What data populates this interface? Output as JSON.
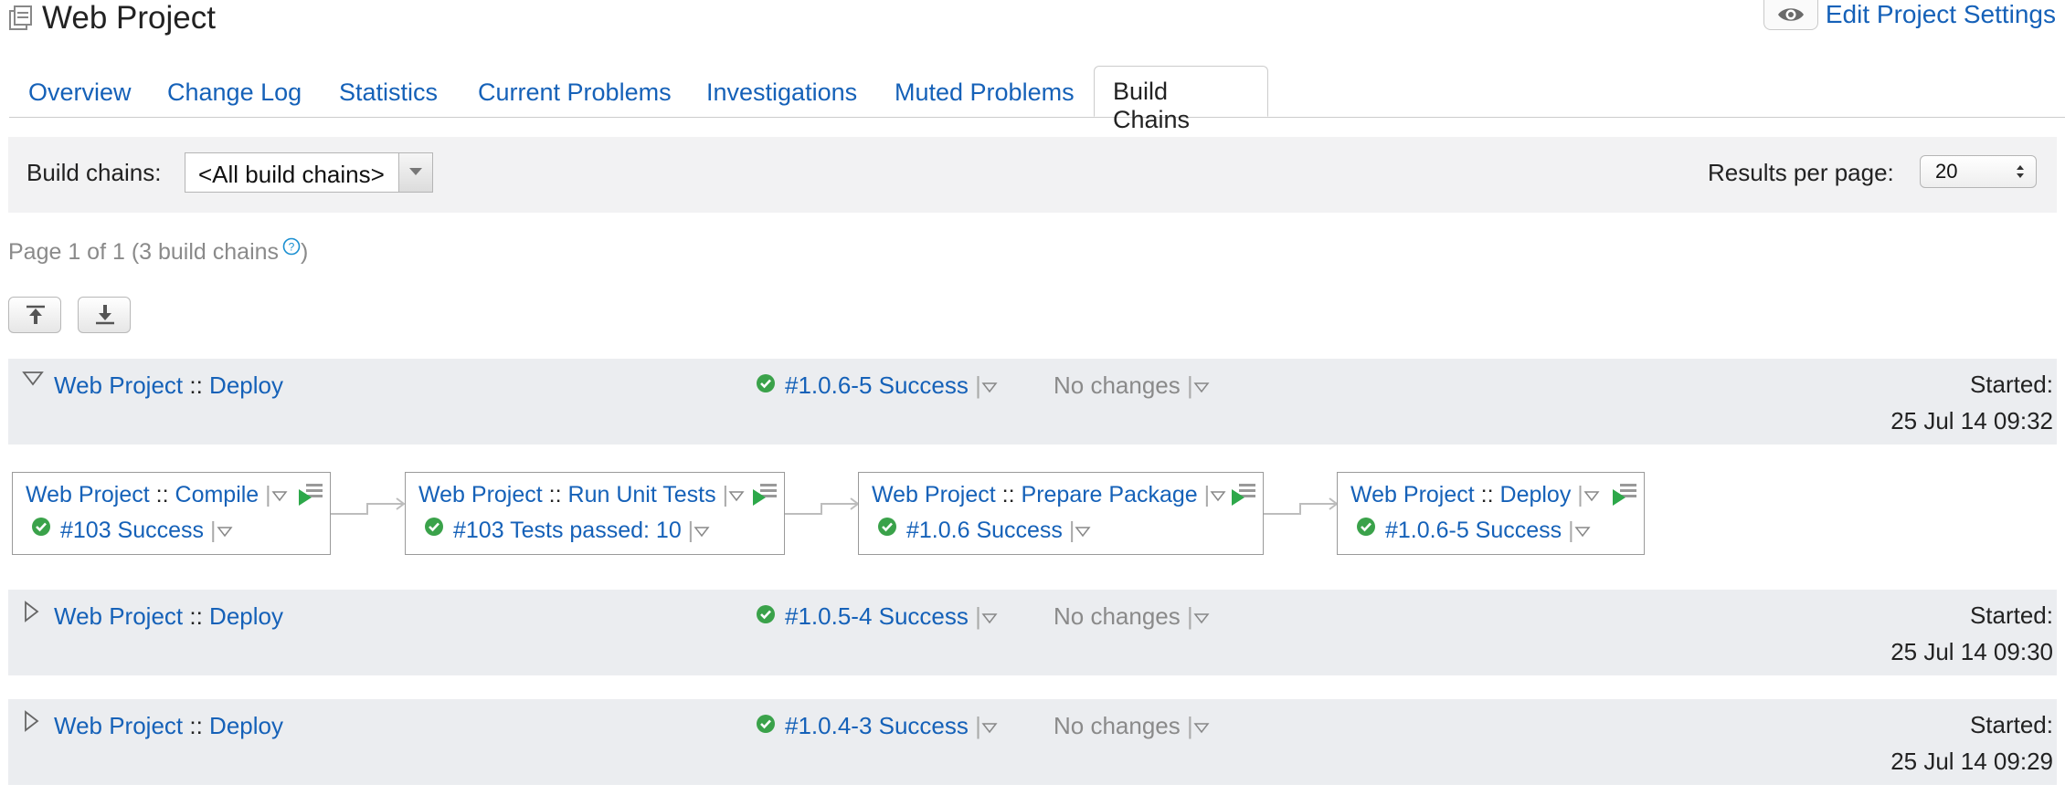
{
  "header": {
    "title": "Web Project",
    "edit_settings": "Edit Project Settings"
  },
  "tabs": [
    {
      "label": "Overview"
    },
    {
      "label": "Change Log"
    },
    {
      "label": "Statistics"
    },
    {
      "label": "Current Problems"
    },
    {
      "label": "Investigations"
    },
    {
      "label": "Muted Problems"
    },
    {
      "label": "Build Chains",
      "active": true
    }
  ],
  "filter": {
    "build_chains_label": "Build chains:",
    "build_chains_value": "<All build chains>",
    "results_per_page_label": "Results per page:",
    "results_per_page_value": "20"
  },
  "page_info": {
    "text": "Page 1 of 1 (3 build chains",
    "close": ")"
  },
  "chains": [
    {
      "project": "Web Project",
      "sep": " :: ",
      "config": "Deploy",
      "build": "#1.0.6-5 Success",
      "changes": "No changes",
      "started_label": "Started:",
      "started_time": "25 Jul 14 09:32",
      "expanded": true
    },
    {
      "project": "Web Project",
      "sep": " :: ",
      "config": "Deploy",
      "build": "#1.0.5-4 Success",
      "changes": "No changes",
      "started_label": "Started:",
      "started_time": "25 Jul 14 09:30",
      "expanded": false
    },
    {
      "project": "Web Project",
      "sep": " :: ",
      "config": "Deploy",
      "build": "#1.0.4-3 Success",
      "changes": "No changes",
      "started_label": "Started:",
      "started_time": "25 Jul 14 09:29",
      "expanded": false
    }
  ],
  "chain_nodes": [
    {
      "project": "Web Project",
      "sep": " :: ",
      "config": "Compile",
      "status": "#103 Success"
    },
    {
      "project": "Web Project",
      "sep": " :: ",
      "config": "Run Unit Tests",
      "status": "#103 Tests passed: 10"
    },
    {
      "project": "Web Project",
      "sep": " :: ",
      "config": "Prepare Package",
      "status": "#1.0.6 Success"
    },
    {
      "project": "Web Project",
      "sep": " :: ",
      "config": "Deploy",
      "status": "#1.0.6-5 Success"
    }
  ],
  "colors": {
    "link": "#1561b8",
    "success": "#3aa24a",
    "row_bg": "#ebedf0",
    "filter_bg": "#f2f2f3"
  },
  "icons": [
    "project-icon",
    "eye-icon",
    "help-icon",
    "collapse-all-icon",
    "expand-all-icon",
    "success-icon",
    "dropdown-triangle-icon",
    "run-build-icon",
    "expand-row-icon",
    "collapse-row-icon"
  ]
}
